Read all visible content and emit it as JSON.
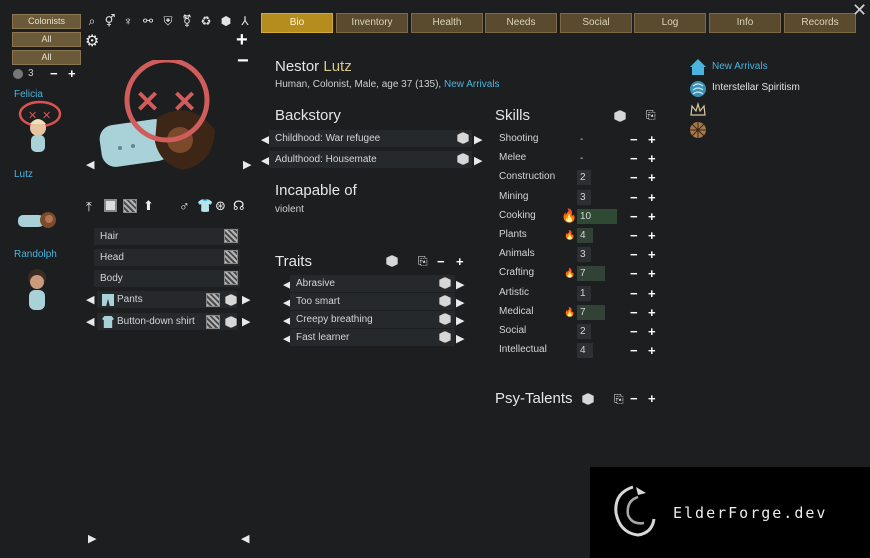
{
  "colonist_bar": {
    "filter_buttons": [
      "Colonists",
      "All",
      "All"
    ],
    "count": "3",
    "colonists": [
      "Felicia",
      "Lutz",
      "Randolph"
    ]
  },
  "tabs": [
    {
      "label": "Bio",
      "active": true
    },
    {
      "label": "Inventory",
      "active": false
    },
    {
      "label": "Health",
      "active": false
    },
    {
      "label": "Needs",
      "active": false
    },
    {
      "label": "Social",
      "active": false
    },
    {
      "label": "Log",
      "active": false
    },
    {
      "label": "Info",
      "active": false
    },
    {
      "label": "Records",
      "active": false
    }
  ],
  "pawn": {
    "first": "Nestor",
    "nick": "Lutz",
    "description": "Human, Colonist, Male, age 37 (135), ",
    "faction": "New Arrivals"
  },
  "backstory": {
    "title": "Backstory",
    "childhood": "Childhood: War refugee",
    "adulthood": "Adulthood: Housemate"
  },
  "incapable": {
    "title": "Incapable of",
    "value": "violent"
  },
  "traits": {
    "title": "Traits",
    "items": [
      "Abrasive",
      "Too smart",
      "Creepy breathing",
      "Fast learner"
    ]
  },
  "appearance": {
    "rows": [
      "Hair",
      "Head",
      "Body"
    ],
    "apparel": [
      "Pants",
      "Button-down shirt"
    ]
  },
  "skills": {
    "title": "Skills",
    "items": [
      {
        "name": "Shooting",
        "value": "-",
        "passion": "none"
      },
      {
        "name": "Melee",
        "value": "-",
        "passion": "none"
      },
      {
        "name": "Construction",
        "value": "2",
        "passion": "none"
      },
      {
        "name": "Mining",
        "value": "3",
        "passion": "none"
      },
      {
        "name": "Cooking",
        "value": "10",
        "passion": "major"
      },
      {
        "name": "Plants",
        "value": "4",
        "passion": "minor"
      },
      {
        "name": "Animals",
        "value": "3",
        "passion": "none"
      },
      {
        "name": "Crafting",
        "value": "7",
        "passion": "minor"
      },
      {
        "name": "Artistic",
        "value": "1",
        "passion": "none"
      },
      {
        "name": "Medical",
        "value": "7",
        "passion": "minor"
      },
      {
        "name": "Social",
        "value": "2",
        "passion": "none"
      },
      {
        "name": "Intellectual",
        "value": "4",
        "passion": "none"
      }
    ]
  },
  "psy": {
    "title": "Psy-Talents"
  },
  "faction_panel": {
    "faction": "New Arrivals",
    "ideo": "Interstellar Spiritism"
  },
  "watermark": {
    "text": "ElderForge.dev"
  },
  "colors": {
    "accent": "#4ab3de",
    "tab_active": "#b58d1e",
    "tab": "#5a4a2e",
    "flame": "#f0a21a",
    "dead_marker": "#d9534f"
  }
}
